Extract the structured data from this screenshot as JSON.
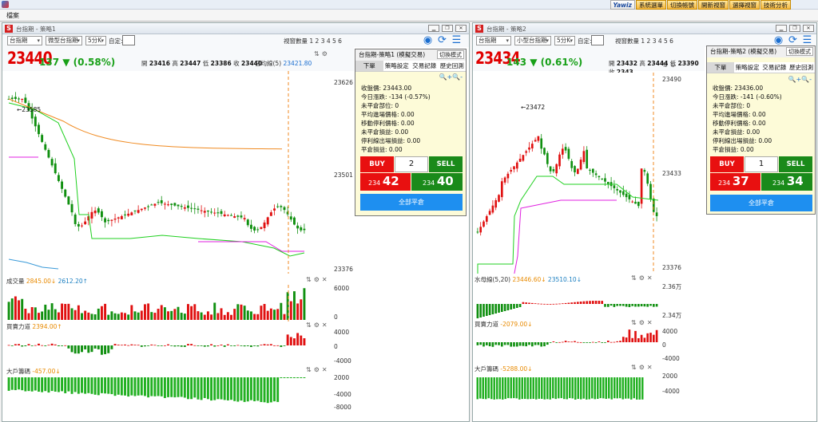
{
  "app": {
    "menu_file": "檔案",
    "toolbar": [
      "系統選單",
      "切換帳號",
      "開新視窗",
      "選擇視窗",
      "技術分析"
    ],
    "brand": "Yawiz",
    "colors": {
      "up": "#e00000",
      "down": "#18a018",
      "panel_bg": "#fdfbd8"
    }
  },
  "windows": [
    {
      "title": "台指期 - 策略1",
      "market": "台指期",
      "product": "微型台指期",
      "interval": "5分K",
      "custom_label": "自定:",
      "view_count": "視窗數量 1 2 3 4 5 6",
      "price": "23440",
      "change": "137 ▼ (0.58%)",
      "open_label": "開",
      "open": "23416",
      "high_label": "高",
      "high": "23447",
      "low_label": "低",
      "low": "23386",
      "close_label": "收",
      "close": "23440",
      "ma_label": "日均線(5)",
      "ma_value": "23421.80",
      "price_axis": [
        "23626",
        "23501",
        "23376"
      ],
      "hi_mark": "←23585",
      "volume_label": "成交量",
      "volume_a": "2845.00↓",
      "volume_b": "2612.20↑",
      "volume_axis": [
        "6000",
        "0"
      ],
      "force_label": "買賣力道",
      "force_value": "2394.00↑",
      "force_axis": [
        "4000",
        "0",
        "-4000"
      ],
      "big_label": "大戶籌碼",
      "big_value": "-457.00↓",
      "big_axis": [
        "2000",
        "-4000",
        "-8000"
      ],
      "panel": {
        "title": "台指期-策略1 (模擬交易)",
        "switch_mode": "切換模式",
        "tabs": [
          "下單",
          "策略設定",
          "交易記錄",
          "歷史回測"
        ],
        "lines": [
          "收盤價: 23443.00",
          "今日漲跌: -134 (-0.57%)",
          "未平倉部位: 0",
          "平均進場價格: 0.00",
          "移動停利價格: 0.00",
          "未平倉損益: 0.00",
          "停利線出場損益: 0.00",
          "平倉損益: 0.00"
        ],
        "buy": "BUY",
        "sell": "SELL",
        "qty": "2",
        "bid_small": "234",
        "bid_big": "42",
        "ask_small": "234",
        "ask_big": "40",
        "close_all": "全部平倉"
      }
    },
    {
      "title": "台指期 - 策略2",
      "market": "台指期",
      "product": "小型台指期",
      "interval": "5分K",
      "custom_label": "自定:",
      "view_count": "視窗數量 1 2 3 4 5 6",
      "price": "23434",
      "change": "143 ▼ (0.61%)",
      "open_label": "開",
      "open": "23432",
      "high_label": "高",
      "high": "23444",
      "low_label": "低",
      "low": "23390",
      "close_label": "收",
      "close": "2343",
      "price_axis": [
        "23490",
        "23433",
        "23376"
      ],
      "hi_mark": "←23472",
      "ma_label": "水母線(5,20)",
      "ma_a": "23446.60↓",
      "ma_b": "23510.10↓",
      "ma_axis": [
        "2.36万",
        "2.34万"
      ],
      "force_label": "買賣力道",
      "force_value": "-2079.00↓",
      "force_axis": [
        "4000",
        "0",
        "-4000"
      ],
      "big_label": "大戶籌碼",
      "big_value": "-5288.00↓",
      "big_axis": [
        "2000",
        "-4000"
      ],
      "panel": {
        "title": "台指期-策略2 (模擬交易)",
        "switch_mode": "切換模式",
        "tabs": [
          "下單",
          "策略設定",
          "交易記錄",
          "歷史回測"
        ],
        "lines": [
          "收盤價: 23436.00",
          "今日漲跌: -141 (-0.60%)",
          "未平倉部位: 0",
          "平均進場價格: 0.00",
          "移動停利價格: 0.00",
          "未平倉損益: 0.00",
          "停利線出場損益: 0.00",
          "平倉損益: 0.00"
        ],
        "buy": "BUY",
        "sell": "SELL",
        "qty": "1",
        "bid_small": "234",
        "bid_big": "37",
        "ask_small": "234",
        "ask_big": "34",
        "close_all": "全部平倉"
      }
    }
  ]
}
